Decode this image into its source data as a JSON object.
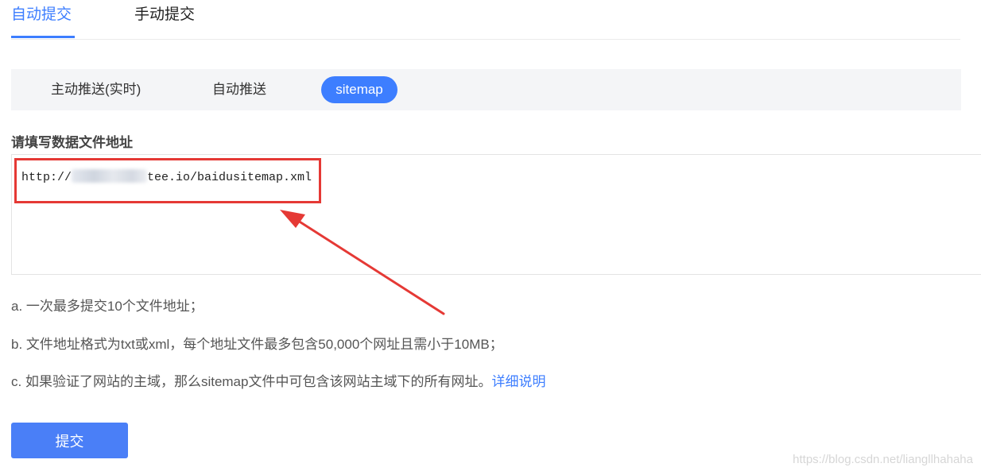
{
  "tabs": [
    {
      "label": "自动提交",
      "active": true
    },
    {
      "label": "手动提交",
      "active": false
    }
  ],
  "subnav": [
    {
      "label": "主动推送(实时)",
      "active": false
    },
    {
      "label": "自动推送",
      "active": false
    },
    {
      "label": "sitemap",
      "active": true
    }
  ],
  "form": {
    "label": "请填写数据文件地址",
    "url_prefix": "http://",
    "url_suffix": "tee.io/baidusitemap.xml"
  },
  "notes": {
    "a": "a. 一次最多提交10个文件地址；",
    "b": "b. 文件地址格式为txt或xml，每个地址文件最多包含50,000个网址且需小于10MB；",
    "c": "c. 如果验证了网站的主域，那么sitemap文件中可包含该网站主域下的所有网址。",
    "c_link": "详细说明"
  },
  "submit_label": "提交",
  "watermark": "https://blog.csdn.net/liangllhahaha",
  "colors": {
    "accent": "#3d7eff",
    "highlight": "#e53935"
  }
}
